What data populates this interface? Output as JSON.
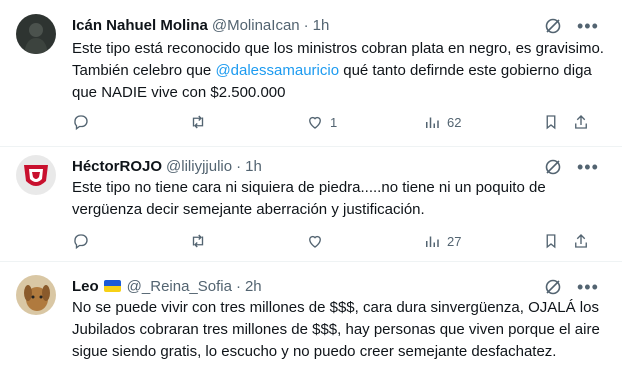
{
  "tweets": [
    {
      "display_name": "Icán Nahuel Molina",
      "handle": "@MolinaIcan",
      "sep": "·",
      "time": "1h",
      "text_before": "Este tipo está reconocido que los ministros cobran plata en negro, es gravisimo. También celebro que ",
      "mention": "@dalessamauricio",
      "text_after": " qué tanto defirnde este gobierno diga que NADIE vive con $2.500.000",
      "replies": "",
      "retweets": "",
      "likes": "1",
      "views": "62"
    },
    {
      "display_name": "HéctorROJO",
      "handle": "@liliyjjulio",
      "sep": "·",
      "time": "1h",
      "text": "Este tipo no tiene cara ni siquiera de piedra.....no tiene ni un poquito de vergüenza decir semejante aberración y justificación.",
      "replies": "",
      "retweets": "",
      "likes": "",
      "views": "27"
    },
    {
      "display_name": "Leo",
      "handle": "@_Reina_Sofia",
      "sep": "·",
      "time": "2h",
      "text": "No se puede vivir con tres millones de $$$, cara dura sinvergüenza, OJALÁ los Jubilados cobraran tres millones de $$$, hay personas que viven porque el aire sigue siendo gratis, lo escucho y no puedo creer semejante desfachatez."
    }
  ],
  "icons": {
    "top": [
      "grok-icon",
      "more-icon"
    ],
    "actions": [
      "reply-icon",
      "retweet-icon",
      "like-icon",
      "views-icon",
      "bookmark-icon",
      "share-icon"
    ]
  },
  "colors": {
    "link": "#1d9bf0",
    "secondary": "#536471",
    "text": "#0f1419",
    "divider": "#eff3f4"
  }
}
